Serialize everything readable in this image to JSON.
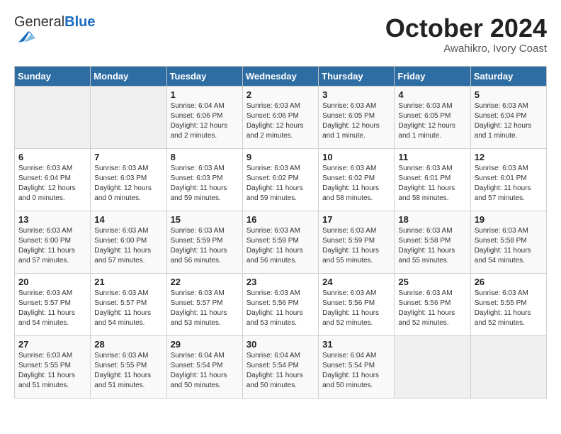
{
  "header": {
    "logo_general": "General",
    "logo_blue": "Blue",
    "month_year": "October 2024",
    "location": "Awahikro, Ivory Coast"
  },
  "weekdays": [
    "Sunday",
    "Monday",
    "Tuesday",
    "Wednesday",
    "Thursday",
    "Friday",
    "Saturday"
  ],
  "weeks": [
    [
      {
        "day": "",
        "empty": true
      },
      {
        "day": "",
        "empty": true
      },
      {
        "day": "1",
        "sunrise": "Sunrise: 6:04 AM",
        "sunset": "Sunset: 6:06 PM",
        "daylight": "Daylight: 12 hours and 2 minutes."
      },
      {
        "day": "2",
        "sunrise": "Sunrise: 6:03 AM",
        "sunset": "Sunset: 6:06 PM",
        "daylight": "Daylight: 12 hours and 2 minutes."
      },
      {
        "day": "3",
        "sunrise": "Sunrise: 6:03 AM",
        "sunset": "Sunset: 6:05 PM",
        "daylight": "Daylight: 12 hours and 1 minute."
      },
      {
        "day": "4",
        "sunrise": "Sunrise: 6:03 AM",
        "sunset": "Sunset: 6:05 PM",
        "daylight": "Daylight: 12 hours and 1 minute."
      },
      {
        "day": "5",
        "sunrise": "Sunrise: 6:03 AM",
        "sunset": "Sunset: 6:04 PM",
        "daylight": "Daylight: 12 hours and 1 minute."
      }
    ],
    [
      {
        "day": "6",
        "sunrise": "Sunrise: 6:03 AM",
        "sunset": "Sunset: 6:04 PM",
        "daylight": "Daylight: 12 hours and 0 minutes."
      },
      {
        "day": "7",
        "sunrise": "Sunrise: 6:03 AM",
        "sunset": "Sunset: 6:03 PM",
        "daylight": "Daylight: 12 hours and 0 minutes."
      },
      {
        "day": "8",
        "sunrise": "Sunrise: 6:03 AM",
        "sunset": "Sunset: 6:03 PM",
        "daylight": "Daylight: 11 hours and 59 minutes."
      },
      {
        "day": "9",
        "sunrise": "Sunrise: 6:03 AM",
        "sunset": "Sunset: 6:02 PM",
        "daylight": "Daylight: 11 hours and 59 minutes."
      },
      {
        "day": "10",
        "sunrise": "Sunrise: 6:03 AM",
        "sunset": "Sunset: 6:02 PM",
        "daylight": "Daylight: 11 hours and 58 minutes."
      },
      {
        "day": "11",
        "sunrise": "Sunrise: 6:03 AM",
        "sunset": "Sunset: 6:01 PM",
        "daylight": "Daylight: 11 hours and 58 minutes."
      },
      {
        "day": "12",
        "sunrise": "Sunrise: 6:03 AM",
        "sunset": "Sunset: 6:01 PM",
        "daylight": "Daylight: 11 hours and 57 minutes."
      }
    ],
    [
      {
        "day": "13",
        "sunrise": "Sunrise: 6:03 AM",
        "sunset": "Sunset: 6:00 PM",
        "daylight": "Daylight: 11 hours and 57 minutes."
      },
      {
        "day": "14",
        "sunrise": "Sunrise: 6:03 AM",
        "sunset": "Sunset: 6:00 PM",
        "daylight": "Daylight: 11 hours and 57 minutes."
      },
      {
        "day": "15",
        "sunrise": "Sunrise: 6:03 AM",
        "sunset": "Sunset: 5:59 PM",
        "daylight": "Daylight: 11 hours and 56 minutes."
      },
      {
        "day": "16",
        "sunrise": "Sunrise: 6:03 AM",
        "sunset": "Sunset: 5:59 PM",
        "daylight": "Daylight: 11 hours and 56 minutes."
      },
      {
        "day": "17",
        "sunrise": "Sunrise: 6:03 AM",
        "sunset": "Sunset: 5:59 PM",
        "daylight": "Daylight: 11 hours and 55 minutes."
      },
      {
        "day": "18",
        "sunrise": "Sunrise: 6:03 AM",
        "sunset": "Sunset: 5:58 PM",
        "daylight": "Daylight: 11 hours and 55 minutes."
      },
      {
        "day": "19",
        "sunrise": "Sunrise: 6:03 AM",
        "sunset": "Sunset: 5:58 PM",
        "daylight": "Daylight: 11 hours and 54 minutes."
      }
    ],
    [
      {
        "day": "20",
        "sunrise": "Sunrise: 6:03 AM",
        "sunset": "Sunset: 5:57 PM",
        "daylight": "Daylight: 11 hours and 54 minutes."
      },
      {
        "day": "21",
        "sunrise": "Sunrise: 6:03 AM",
        "sunset": "Sunset: 5:57 PM",
        "daylight": "Daylight: 11 hours and 54 minutes."
      },
      {
        "day": "22",
        "sunrise": "Sunrise: 6:03 AM",
        "sunset": "Sunset: 5:57 PM",
        "daylight": "Daylight: 11 hours and 53 minutes."
      },
      {
        "day": "23",
        "sunrise": "Sunrise: 6:03 AM",
        "sunset": "Sunset: 5:56 PM",
        "daylight": "Daylight: 11 hours and 53 minutes."
      },
      {
        "day": "24",
        "sunrise": "Sunrise: 6:03 AM",
        "sunset": "Sunset: 5:56 PM",
        "daylight": "Daylight: 11 hours and 52 minutes."
      },
      {
        "day": "25",
        "sunrise": "Sunrise: 6:03 AM",
        "sunset": "Sunset: 5:56 PM",
        "daylight": "Daylight: 11 hours and 52 minutes."
      },
      {
        "day": "26",
        "sunrise": "Sunrise: 6:03 AM",
        "sunset": "Sunset: 5:55 PM",
        "daylight": "Daylight: 11 hours and 52 minutes."
      }
    ],
    [
      {
        "day": "27",
        "sunrise": "Sunrise: 6:03 AM",
        "sunset": "Sunset: 5:55 PM",
        "daylight": "Daylight: 11 hours and 51 minutes."
      },
      {
        "day": "28",
        "sunrise": "Sunrise: 6:03 AM",
        "sunset": "Sunset: 5:55 PM",
        "daylight": "Daylight: 11 hours and 51 minutes."
      },
      {
        "day": "29",
        "sunrise": "Sunrise: 6:04 AM",
        "sunset": "Sunset: 5:54 PM",
        "daylight": "Daylight: 11 hours and 50 minutes."
      },
      {
        "day": "30",
        "sunrise": "Sunrise: 6:04 AM",
        "sunset": "Sunset: 5:54 PM",
        "daylight": "Daylight: 11 hours and 50 minutes."
      },
      {
        "day": "31",
        "sunrise": "Sunrise: 6:04 AM",
        "sunset": "Sunset: 5:54 PM",
        "daylight": "Daylight: 11 hours and 50 minutes."
      },
      {
        "day": "",
        "empty": true
      },
      {
        "day": "",
        "empty": true
      }
    ]
  ]
}
